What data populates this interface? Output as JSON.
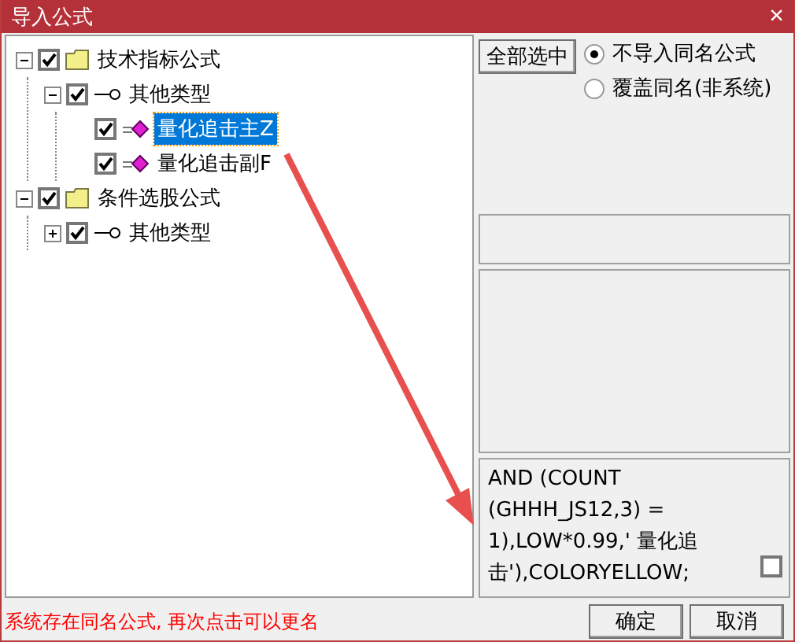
{
  "window": {
    "title": "导入公式",
    "close": "×"
  },
  "tree": [
    {
      "label": "技术指标公式",
      "kind": "folder",
      "checked": true,
      "expanded": true,
      "selected": false,
      "children": [
        {
          "label": "其他类型",
          "kind": "category",
          "checked": true,
          "expanded": true,
          "selected": false,
          "children": [
            {
              "label": "量化追击主Z",
              "kind": "formula",
              "checked": true,
              "selected": true
            },
            {
              "label": "量化追击副F",
              "kind": "formula",
              "checked": true,
              "selected": false
            }
          ]
        }
      ]
    },
    {
      "label": "条件选股公式",
      "kind": "folder",
      "checked": true,
      "expanded": true,
      "selected": false,
      "children": [
        {
          "label": "其他类型",
          "kind": "category",
          "checked": true,
          "expanded": false,
          "selected": false
        }
      ]
    }
  ],
  "select_all_button": "全部选中",
  "options": [
    {
      "label": "不导入同名公式",
      "selected": true
    },
    {
      "label": "覆盖同名(非系统)",
      "selected": false
    }
  ],
  "code_text": "AND (COUNT (GHHH_JS12,3) = 1),LOW*0.99,' 量化追击'),COLORYELLOW;",
  "code_checkbox": {
    "checked": false
  },
  "status": "系统存在同名公式, 再次点击可以更名",
  "buttons": [
    "确定",
    "取消"
  ],
  "annotation": {
    "kind": "arrow"
  }
}
